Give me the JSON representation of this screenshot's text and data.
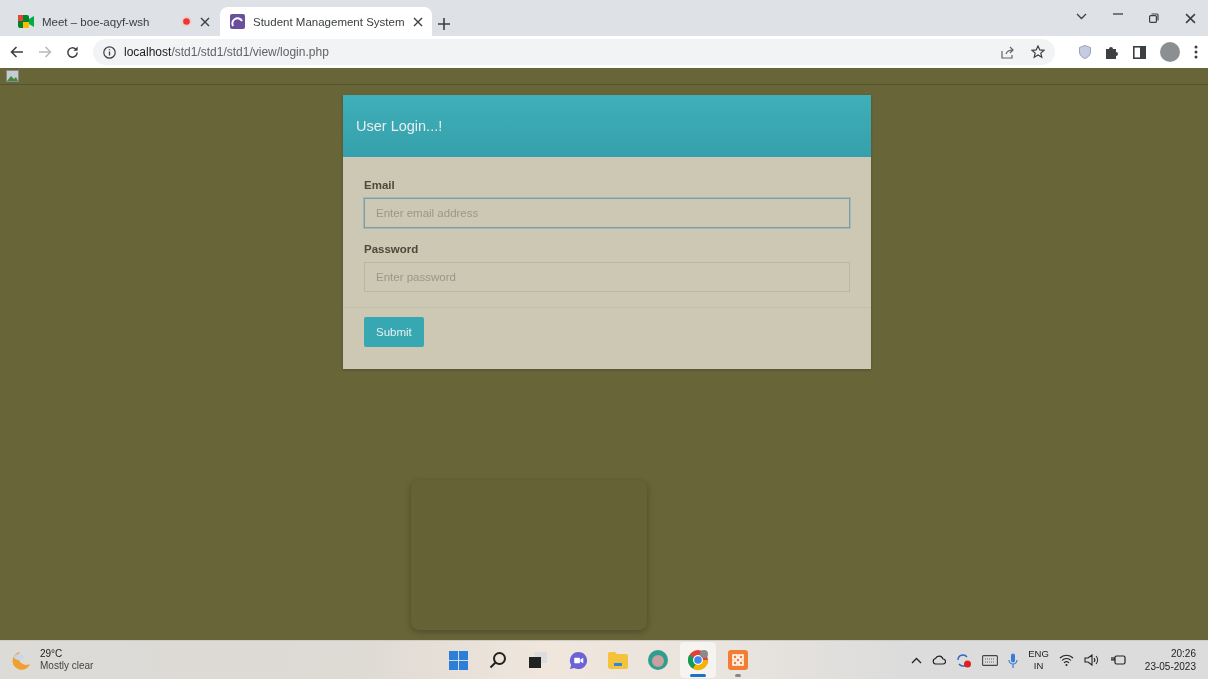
{
  "tabs": [
    {
      "title": "Meet – boe-aqyf-wsh",
      "kind": "meet",
      "recording": true,
      "selected": false
    },
    {
      "title": "Student Management System",
      "kind": "app",
      "recording": false,
      "selected": true
    }
  ],
  "toolbar": {
    "back_disabled": false,
    "forward_disabled": true,
    "url_host": "localhost",
    "url_path": "/std1/std1/std1/view/login.php"
  },
  "login": {
    "title": "User Login...!",
    "fields": [
      {
        "label": "Email",
        "placeholder": "Enter email address",
        "focused": true
      },
      {
        "label": "Password",
        "placeholder": "Enter password",
        "focused": false
      }
    ],
    "submit": "Submit"
  },
  "taskbar": {
    "weather": {
      "temp": "29°C",
      "condition": "Mostly clear"
    },
    "apps": [
      {
        "kind": "start",
        "running": false,
        "focused": false
      },
      {
        "kind": "search",
        "running": false,
        "focused": false
      },
      {
        "kind": "taskview",
        "running": false,
        "focused": false
      },
      {
        "kind": "chat",
        "running": false,
        "focused": false
      },
      {
        "kind": "explorer",
        "running": false,
        "focused": false
      },
      {
        "kind": "edge",
        "running": false,
        "focused": false
      },
      {
        "kind": "chrome",
        "running": true,
        "focused": true
      },
      {
        "kind": "xampp",
        "running": true,
        "focused": false
      }
    ],
    "language": [
      "ENG",
      "IN"
    ],
    "time": "20:26",
    "date": "23-05-2023"
  }
}
